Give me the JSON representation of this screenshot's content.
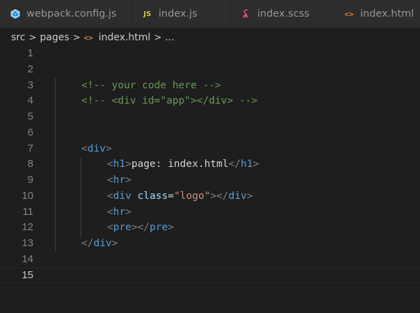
{
  "tabs": [
    {
      "label": "webpack.config.js",
      "icon": "webpack-cube-icon"
    },
    {
      "label": "index.js",
      "icon": "js-file-icon",
      "badge": "JS"
    },
    {
      "label": "index.scss",
      "icon": "sass-file-icon"
    },
    {
      "label": "index.html",
      "icon": "html-file-icon",
      "glyph": "<>"
    }
  ],
  "breadcrumb": {
    "items": [
      "src",
      "pages",
      "index.html",
      "..."
    ],
    "separator": ">",
    "file_icon": "<>"
  },
  "editor": {
    "current_line": 15,
    "lines": [
      {
        "n": "1"
      },
      {
        "n": "2"
      },
      {
        "n": "3",
        "tokens": [
          {
            "t": "<!-- your code here -->",
            "k": "comment"
          }
        ]
      },
      {
        "n": "4",
        "tokens": [
          {
            "t": "<!-- <div id=\"app\"></div> -->",
            "k": "comment"
          }
        ]
      },
      {
        "n": "5"
      },
      {
        "n": "6"
      },
      {
        "n": "7",
        "tokens": [
          {
            "t": "<",
            "k": "bracket"
          },
          {
            "t": "div",
            "k": "tag"
          },
          {
            "t": ">",
            "k": "bracket"
          }
        ]
      },
      {
        "n": "8",
        "tokens": [
          {
            "t": "<",
            "k": "bracket"
          },
          {
            "t": "h1",
            "k": "tag"
          },
          {
            "t": ">",
            "k": "bracket"
          },
          {
            "t": "page: index.html",
            "k": "text"
          },
          {
            "t": "</",
            "k": "bracket"
          },
          {
            "t": "h1",
            "k": "tag"
          },
          {
            "t": ">",
            "k": "bracket"
          }
        ]
      },
      {
        "n": "9",
        "tokens": [
          {
            "t": "<",
            "k": "bracket"
          },
          {
            "t": "hr",
            "k": "tag"
          },
          {
            "t": ">",
            "k": "bracket"
          }
        ]
      },
      {
        "n": "10",
        "tokens": [
          {
            "t": "<",
            "k": "bracket"
          },
          {
            "t": "div",
            "k": "tag"
          },
          {
            "t": " ",
            "k": "text"
          },
          {
            "t": "class",
            "k": "attr"
          },
          {
            "t": "=",
            "k": "text"
          },
          {
            "t": "\"logo\"",
            "k": "str"
          },
          {
            "t": "></",
            "k": "bracket"
          },
          {
            "t": "div",
            "k": "tag"
          },
          {
            "t": ">",
            "k": "bracket"
          }
        ]
      },
      {
        "n": "11",
        "tokens": [
          {
            "t": "<",
            "k": "bracket"
          },
          {
            "t": "hr",
            "k": "tag"
          },
          {
            "t": ">",
            "k": "bracket"
          }
        ]
      },
      {
        "n": "12",
        "tokens": [
          {
            "t": "<",
            "k": "bracket"
          },
          {
            "t": "pre",
            "k": "tag"
          },
          {
            "t": "></",
            "k": "bracket"
          },
          {
            "t": "pre",
            "k": "tag"
          },
          {
            "t": ">",
            "k": "bracket"
          }
        ]
      },
      {
        "n": "13",
        "tokens": [
          {
            "t": "</",
            "k": "bracket"
          },
          {
            "t": "div",
            "k": "tag"
          },
          {
            "t": ">",
            "k": "bracket"
          }
        ]
      },
      {
        "n": "14"
      },
      {
        "n": "15"
      }
    ]
  },
  "colors": {
    "background": "#1e1e1e",
    "tab_background": "#2d2d2d",
    "comment": "#6a9955",
    "tag": "#569cd6",
    "bracket": "#808080",
    "attribute": "#9cdcfe",
    "string": "#ce9178",
    "text": "#d4d4d4",
    "line_number": "#858585",
    "webpack_icon": "#8ed6fb",
    "js_icon": "#cbcb41",
    "sass_icon": "#f55385",
    "html_icon": "#e37933"
  }
}
